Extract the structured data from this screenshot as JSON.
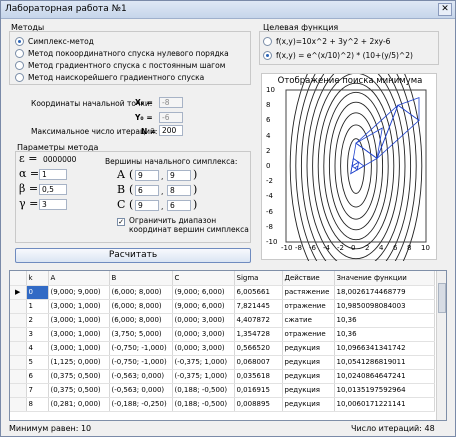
{
  "window": {
    "title": "Лабораторная работа №1",
    "close_label": "✕"
  },
  "methods": {
    "group_label": "Методы",
    "items": [
      {
        "label": "Симплекс-метод",
        "selected": true
      },
      {
        "label": "Метод покоординатного спуска нулевого порядка",
        "selected": false
      },
      {
        "label": "Метод градиентного спуска с постоянным шагом",
        "selected": false
      },
      {
        "label": "Метод наискорейшего градиентного спуска",
        "selected": false
      }
    ]
  },
  "target": {
    "group_label": "Целевая функция",
    "items": [
      {
        "label": "f(x,y)=10x^2 + 3y^2 + 2xy-6",
        "selected": false
      },
      {
        "label": "f(x,y) = e^(x/10)^2) * (10+(y/5)^2)",
        "selected": true
      }
    ]
  },
  "start": {
    "label": "Координаты начальной точки:",
    "x0_label": "X₀ =",
    "x0": "-8",
    "y0_label": "Y₀ =",
    "y0": "-6",
    "maxiter_label": "Максимальное число итераций:",
    "n_label": "N =",
    "n_value": "200"
  },
  "params": {
    "group_label": "Параметры метода",
    "eps_sym": "ε =",
    "eps": "0000000",
    "alpha_sym": "α =",
    "alpha": "1",
    "beta_sym": "β =",
    "beta": "0,5",
    "gamma_sym": "γ =",
    "gamma": "3",
    "vertices_label": "Вершины начального симплекса:",
    "vertices": [
      {
        "name": "A",
        "x": "9",
        "y": "9"
      },
      {
        "name": "B",
        "x": "6",
        "y": "8"
      },
      {
        "name": "C",
        "x": "9",
        "y": "6"
      }
    ],
    "limit_label_1": "Ограничить диапазон",
    "limit_label_2": "координат вершин симплекса",
    "limit_checked": true
  },
  "calc_button": "Расчитать",
  "plot": {
    "title": "Отображение поиска минимума",
    "x_ticks": [
      "-10",
      "-8",
      "-6",
      "-4",
      "-2",
      "0",
      "2",
      "4",
      "6",
      "8",
      "10"
    ],
    "y_ticks": [
      "10",
      "8",
      "6",
      "4",
      "2",
      "0",
      "-2",
      "-4",
      "-6",
      "-8",
      "-10"
    ]
  },
  "table": {
    "columns": [
      "k",
      "A",
      "B",
      "C",
      "Sigma",
      "Действие",
      "Значение функции"
    ],
    "rows": [
      [
        "0",
        "(9,000; 9,000)",
        "(6,000; 8,000)",
        "(9,000; 6,000)",
        "6,005661",
        "растяжение",
        "18,0026174468779"
      ],
      [
        "1",
        "(3,000; 1,000)",
        "(6,000; 8,000)",
        "(9,000; 6,000)",
        "7,821445",
        "отражение",
        "10,9850098084003"
      ],
      [
        "2",
        "(3,000; 1,000)",
        "(6,000; 8,000)",
        "(0,000; 3,000)",
        "4,407872",
        "сжатие",
        "10,36"
      ],
      [
        "3",
        "(3,000; 1,000)",
        "(3,750; 5,000)",
        "(0,000; 3,000)",
        "1,354728",
        "отражение",
        "10,36"
      ],
      [
        "4",
        "(3,000; 1,000)",
        "(-0,750; -1,000)",
        "(0,000; 3,000)",
        "0,566520",
        "редукция",
        "10,0966341341742"
      ],
      [
        "5",
        "(1,125; 0,000)",
        "(-0,750; -1,000)",
        "(-0,375; 1,000)",
        "0,068007",
        "редукция",
        "10,0541286819011"
      ],
      [
        "6",
        "(0,375; 0,500)",
        "(-0,563; 0,000)",
        "(-0,375; 1,000)",
        "0,035618",
        "редукция",
        "10,0240864647241"
      ],
      [
        "7",
        "(0,375; 0,500)",
        "(-0,563; 0,000)",
        "(0,188; -0,500)",
        "0,016915",
        "редукция",
        "10,0135197592964"
      ],
      [
        "8",
        "(0,281; 0,000)",
        "(-0,188; -0,250)",
        "(0,188; -0,500)",
        "0,008895",
        "редукция",
        "10,0060171221141"
      ]
    ]
  },
  "status": {
    "min_text": "Минимум равен: 10",
    "iter_text": "Число итераций: 48"
  }
}
